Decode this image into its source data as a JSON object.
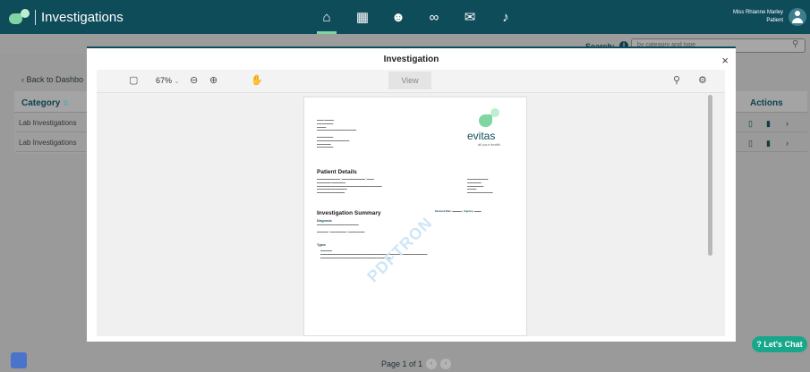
{
  "header": {
    "app_title": "Investigations",
    "nav_icons": [
      "home-icon",
      "calendar-icon",
      "people-icon",
      "link-icon",
      "mail-icon",
      "bell-icon"
    ],
    "user_name": "Miss Rhianne Marley",
    "user_role": "Patient"
  },
  "search": {
    "label": "Search:",
    "placeholder": "by category and type"
  },
  "page": {
    "back_label": "Back to Dashbo",
    "category_header": "Category",
    "categories": [
      "Lab Investigations",
      "Lab Investigations"
    ],
    "actions_header": "Actions",
    "chat_label": "Let's Chat",
    "pager_label": "Page 1 of 1"
  },
  "modal": {
    "title": "Investigation",
    "close": "×",
    "zoom": "67%",
    "view_tab": "View"
  },
  "doc": {
    "brand": "evitas",
    "tagline": "all your health",
    "patient_details_title": "Patient Details",
    "investigation_summary_title": "Investigation Summary",
    "received_label": "Received Date:",
    "urgency_label": "Urgency:",
    "diagnosis_label": "Diagnosis",
    "types_label": "Types",
    "watermark": "PDFTRON"
  },
  "colors": {
    "header_bg": "#0f4c5a",
    "accent_green": "#7fd6a3",
    "chat_bg": "#18a78a"
  }
}
